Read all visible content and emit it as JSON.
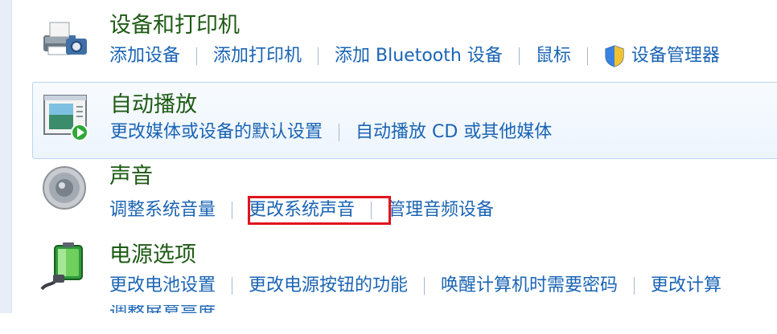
{
  "sections": [
    {
      "title": "设备和打印机",
      "links": [
        "添加设备",
        "添加打印机",
        "添加 Bluetooth 设备",
        "鼠标",
        "设备管理器"
      ]
    },
    {
      "title": "自动播放",
      "links": [
        "更改媒体或设备的默认设置",
        "自动播放 CD 或其他媒体"
      ]
    },
    {
      "title": "声音",
      "links": [
        "调整系统音量",
        "更改系统声音",
        "管理音频设备"
      ]
    },
    {
      "title": "电源选项",
      "links": [
        "更改电池设置",
        "更改电源按钮的功能",
        "唤醒计算机时需要密码",
        "更改计算"
      ],
      "clipped_next_line": "调整屏幕亮度"
    }
  ],
  "highlighted_link": "更改系统声音",
  "colors": {
    "title": "#1e5b14",
    "link": "#1a64b4",
    "highlight_box": "#e0141e",
    "hover_group_border": "#b9d6f2"
  },
  "icons": [
    "printer-icon",
    "autoplay-icon",
    "speaker-icon",
    "battery-power-icon",
    "uac-shield-icon"
  ]
}
